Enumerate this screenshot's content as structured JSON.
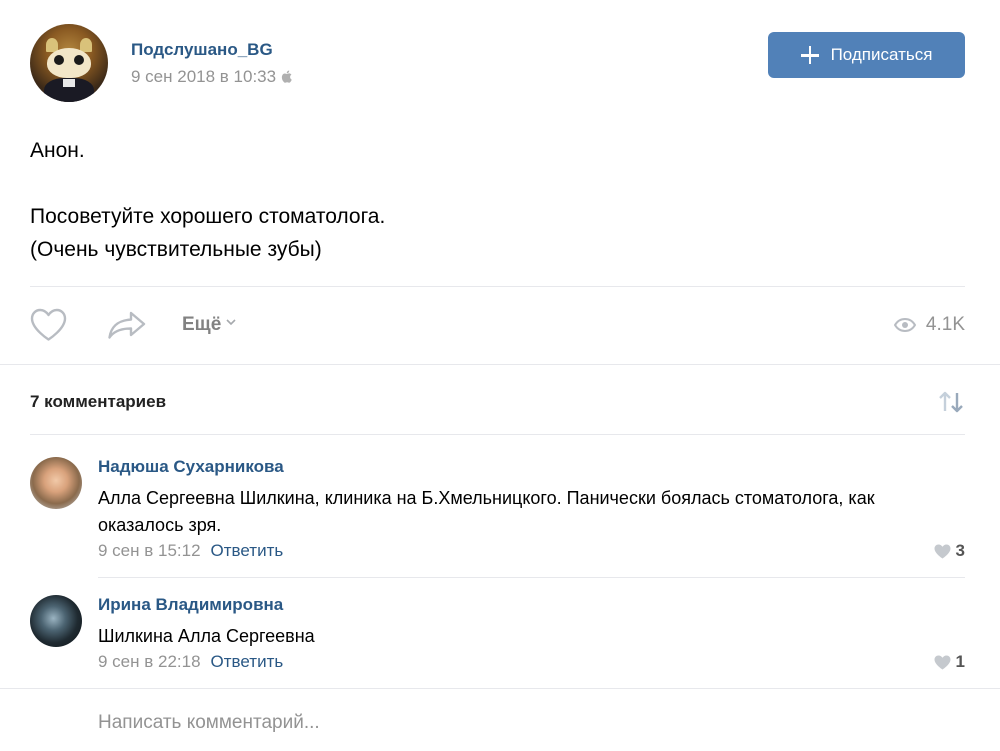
{
  "post": {
    "group_name": "Подслушано_BG",
    "date": "9 сен 2018 в 10:33",
    "subscribe_label": "Подписаться",
    "text_lines": [
      "Анон.",
      "",
      "Посоветуйте хорошего стоматолога.",
      "(Очень чувствительные зубы)"
    ]
  },
  "actions": {
    "more_label": "Ещё",
    "views": "4.1K"
  },
  "comments_section": {
    "count_label": "7 комментариев",
    "write_placeholder": "Написать комментарий..."
  },
  "comments": [
    {
      "author": "Надюша Сухарникова",
      "text": "Алла Сергеевна Шилкина, клиника на Б.Хмельницкого. Панически боялась стоматолога, как оказалось зря.",
      "date": "9 сен в 15:12",
      "reply_label": "Ответить",
      "likes": "3"
    },
    {
      "author": "Ирина Владимировна",
      "text": "Шилкина Алла Сергеевна",
      "date": "9 сен в 22:18",
      "reply_label": "Ответить",
      "likes": "1"
    }
  ],
  "colors": {
    "link": "#2a5885",
    "button": "#5181b8",
    "muted": "#939393",
    "divider": "#e7e8ec"
  },
  "icons": [
    "apple-icon",
    "plus-icon",
    "heart-icon",
    "share-icon",
    "chevron-down-icon",
    "eye-icon",
    "sort-icon"
  ]
}
